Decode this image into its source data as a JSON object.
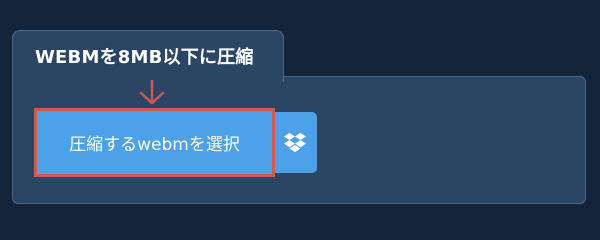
{
  "upload_panel": {
    "title": "WEBMを8MB以下に圧縮",
    "select_button_label": "圧縮するwebmを選択",
    "dropbox_icon": "dropbox-icon",
    "arrow_icon": "arrow-down-icon"
  },
  "colors": {
    "page_background": "#14243a",
    "panel_background": "#2b4665",
    "panel_border": "#4b6888",
    "button_background": "#4da1e8",
    "highlight_border": "#cf5a55",
    "text": "#ffffff"
  }
}
